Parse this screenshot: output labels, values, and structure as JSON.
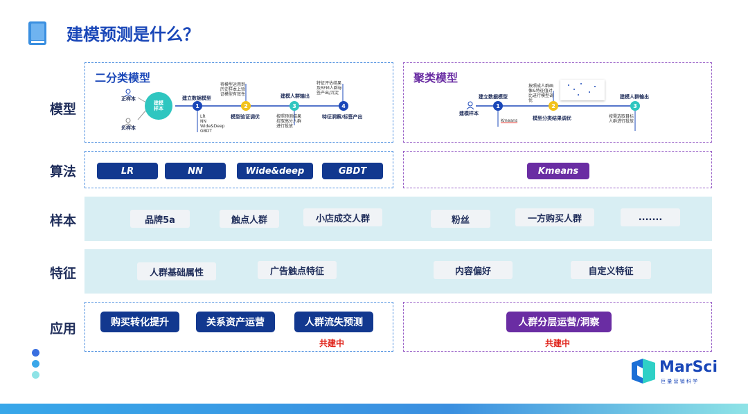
{
  "title": "建模预测是什么？",
  "rows": {
    "model": "模型",
    "algorithm": "算法",
    "sample": "样本",
    "feature": "特征",
    "application": "应用"
  },
  "binary_model": {
    "title": "二分类模型",
    "positive": "正样本",
    "negative": "负样本",
    "center_label": "建模样本",
    "steps": [
      {
        "num": "1",
        "label": "建立数据模型",
        "note": "LR\nNN\nWide&Deep\nGBDT"
      },
      {
        "num": "2",
        "label": "模型验证调优",
        "note": "将模型运用到历史样本上验证模型有效性"
      },
      {
        "num": "3",
        "label": "建模人群输出",
        "note": "按照预测结果拉取高分人群进行投放"
      },
      {
        "num": "4",
        "label": "特征洞察/标签产出",
        "note": "特征评估结果及RFM等人群标签产出/沉淀"
      }
    ],
    "step1_notes": [
      "LR",
      "NN",
      "Wide&Deep",
      "GBDT"
    ],
    "step2_note": "将模型运用到历史样本上验证模型有效性",
    "step3_note": "按照预测结果拉取高分人群进行投放",
    "step4_note": "特征评估结果及RFM人群标签产出/沉淀"
  },
  "cluster_model": {
    "title": "聚类模型",
    "center_label": "建模样本",
    "steps": [
      {
        "num": "1",
        "label": "建立数据模型",
        "note": "Kmeans"
      },
      {
        "num": "2",
        "label": "模型分类结果调优",
        "note": "按照成人群画像&特征值对比进行模型调优"
      },
      {
        "num": "3",
        "label": "建模人群输出",
        "note": "按需选取目标人群进行投放"
      }
    ]
  },
  "algorithms_binary": [
    "LR",
    "NN",
    "Wide&deep",
    "GBDT"
  ],
  "algorithms_cluster": [
    "Kmeans"
  ],
  "samples": [
    "品牌5a",
    "触点人群",
    "小店成交人群",
    "粉丝",
    "一方购买人群",
    "......."
  ],
  "features": [
    "人群基础属性",
    "广告触点特征",
    "内容偏好",
    "自定义特征"
  ],
  "applications_binary": [
    "购买转化提升",
    "关系资产运营",
    "人群流失预测"
  ],
  "applications_cluster": [
    "人群分层运营/洞察"
  ],
  "co_building": "共建中",
  "logo": {
    "name": "MarSci",
    "sub": "巨 量 营 销 科 学"
  },
  "colors": {
    "primary": "#12388f",
    "purple": "#6a2da3",
    "band": "#d8eef3",
    "red": "#e0241b"
  }
}
